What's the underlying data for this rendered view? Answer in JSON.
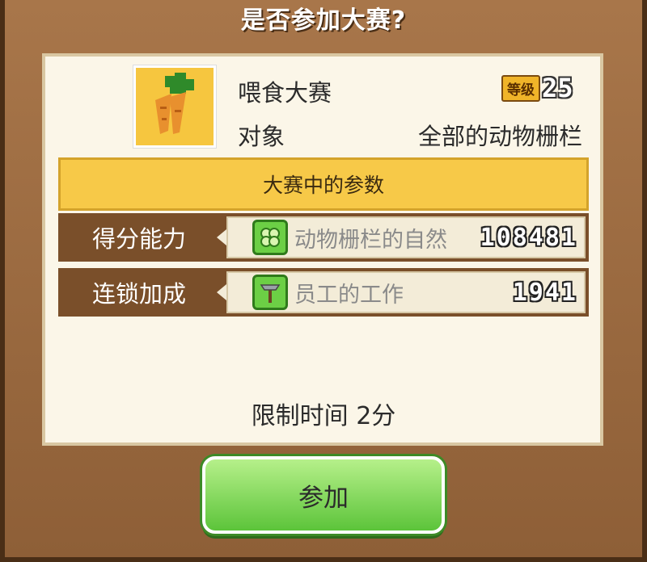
{
  "dialog": {
    "title": "是否参加大赛?",
    "contest_name": "喂食大赛",
    "level_label": "等级",
    "level_value": "25",
    "target_label": "对象",
    "target_value": "全部的动物栅栏",
    "params_header": "大赛中的参数",
    "rows": [
      {
        "label": "得分能力",
        "text": "动物栅栏的自然",
        "value": "108481",
        "icon": "clover-icon"
      },
      {
        "label": "连锁加成",
        "text": "员工的工作",
        "value": "1941",
        "icon": "hammer-icon"
      }
    ],
    "time_limit": "限制时间  2分",
    "join_label": "参加"
  },
  "colors": {
    "frame": "#8e5f37",
    "panel": "#fbf6e8",
    "header": "#f7c948",
    "row_bg": "#7a4f2a",
    "button": "#5cc43a"
  }
}
